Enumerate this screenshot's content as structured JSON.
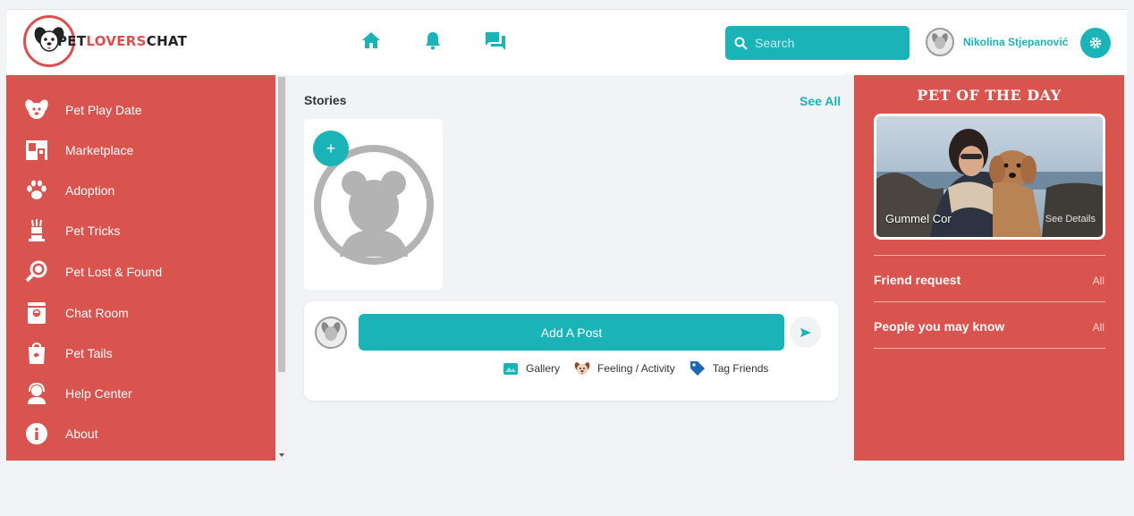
{
  "header": {
    "logo": {
      "text_black_1": "PET",
      "text_red": "LOVERS",
      "text_black_2": "CHAT"
    },
    "nav_icons": [
      "home-icon",
      "bell-icon",
      "chat-icon"
    ],
    "search": {
      "placeholder": "Search"
    },
    "user": {
      "name": "Nikolina Stjepanović"
    }
  },
  "sidebar": {
    "items": [
      {
        "label": "Pet Play Date",
        "icon": "dog-face-icon"
      },
      {
        "label": "Marketplace",
        "icon": "store-icon"
      },
      {
        "label": "Adoption",
        "icon": "paw-icon"
      },
      {
        "label": "Pet Tricks",
        "icon": "magic-hat-icon"
      },
      {
        "label": "Pet Lost & Found",
        "icon": "magnifier-icon"
      },
      {
        "label": "Chat Room",
        "icon": "chat-room-icon"
      },
      {
        "label": "Pet Tails",
        "icon": "shopping-bag-icon"
      },
      {
        "label": "Help Center",
        "icon": "support-agent-icon"
      },
      {
        "label": "About",
        "icon": "info-icon"
      }
    ]
  },
  "main": {
    "stories": {
      "title": "Stories",
      "see_all": "See All",
      "add_symbol": "+"
    },
    "post": {
      "add_post_label": "Add A Post",
      "actions": [
        {
          "label": "Gallery",
          "icon": "gallery-icon"
        },
        {
          "label": "Feeling / Activity",
          "icon": "dog-face-icon"
        },
        {
          "label": "Tag Friends",
          "icon": "tag-icon"
        }
      ]
    }
  },
  "right_panel": {
    "pet_of_the_day": {
      "title": "PET OF THE DAY",
      "pet_name": "Gummel Cor",
      "details_link": "See Details"
    },
    "rows": [
      {
        "label": "Friend request",
        "link": "All"
      },
      {
        "label": "People you may know",
        "link": "All"
      }
    ]
  },
  "colors": {
    "accent": "#1ab3b8",
    "panel_red": "#d9534f",
    "background": "#f1f3f6"
  }
}
